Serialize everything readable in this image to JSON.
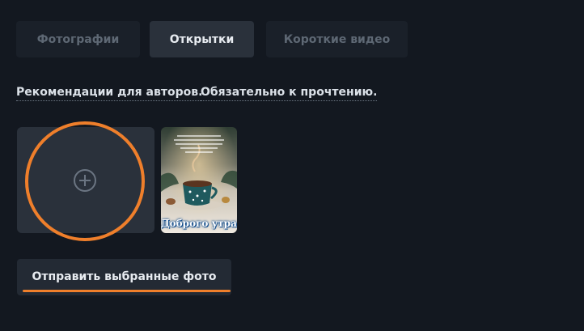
{
  "tabs": [
    {
      "label": "Фотографии",
      "active": false
    },
    {
      "label": "Открытки",
      "active": true
    },
    {
      "label": "Короткие видео",
      "active": false
    }
  ],
  "links": {
    "author_guidelines": "Рекомендации для авторов.",
    "must_read": "Обязательно к прочтению."
  },
  "upload": {
    "icon": "plus-circle-icon"
  },
  "thumbnail": {
    "caption": "Доброго утра!"
  },
  "submit_button": {
    "label": "Отправить выбранные фото"
  },
  "colors": {
    "background": "#131820",
    "tab_active": "#2a313b",
    "highlight": "#ef7f2b"
  }
}
